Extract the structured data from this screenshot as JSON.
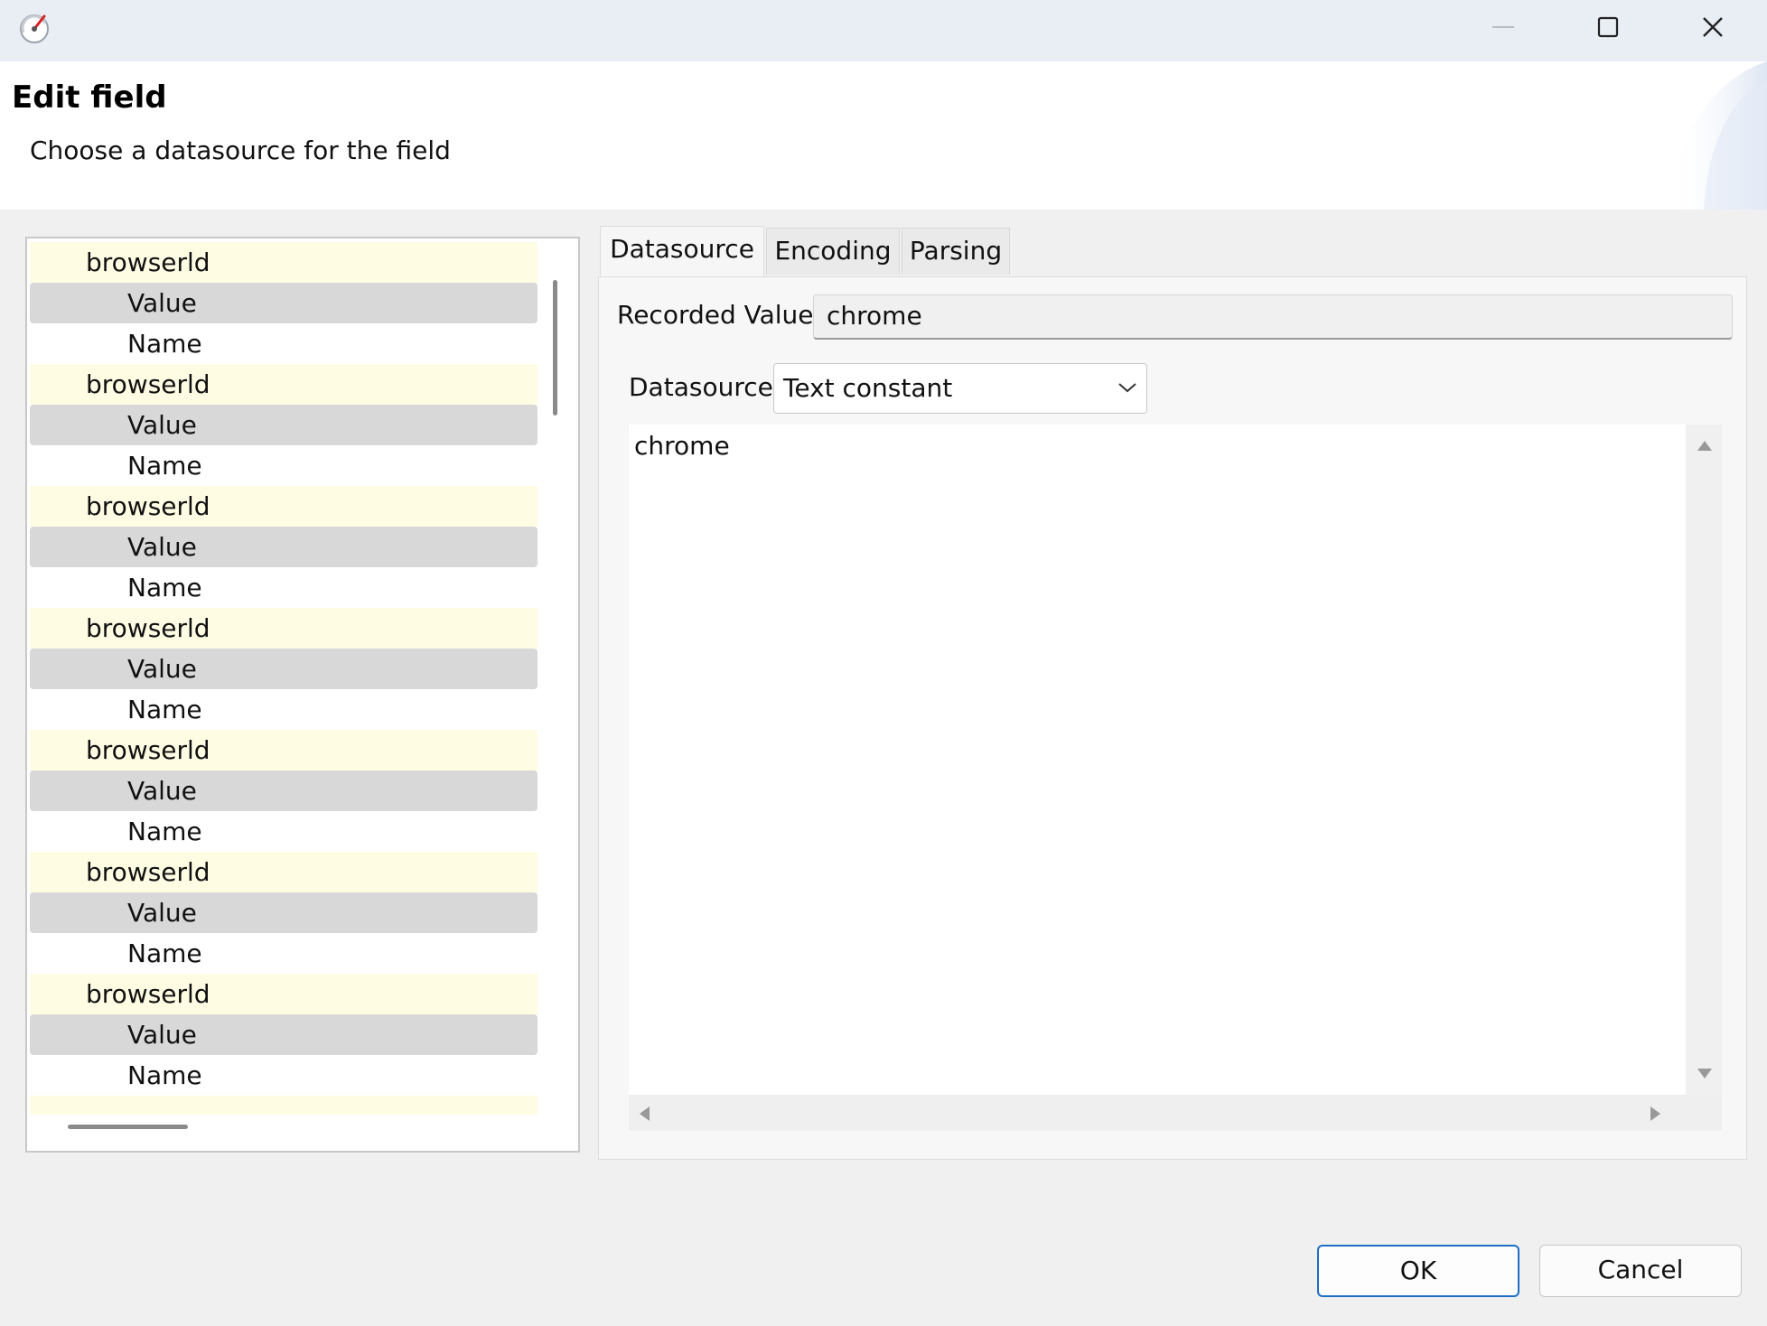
{
  "window": {
    "app_icon": "gauge-icon",
    "controls": {
      "minimize": "minimize-icon",
      "maximize": "maximize-icon",
      "close": "close-icon"
    }
  },
  "header": {
    "title": "Edit field",
    "subtitle": "Choose a datasource for the field"
  },
  "tree": {
    "groups": [
      {
        "parent": "browserld",
        "children": [
          "Value",
          "Name"
        ]
      },
      {
        "parent": "browserld",
        "children": [
          "Value",
          "Name"
        ]
      },
      {
        "parent": "browserld",
        "children": [
          "Value",
          "Name"
        ]
      },
      {
        "parent": "browserld",
        "children": [
          "Value",
          "Name"
        ]
      },
      {
        "parent": "browserld",
        "children": [
          "Value",
          "Name"
        ]
      },
      {
        "parent": "browserld",
        "children": [
          "Value",
          "Name"
        ]
      },
      {
        "parent": "browserld",
        "children": [
          "Value",
          "Name"
        ]
      }
    ],
    "selected_color": "#d8d8d8",
    "parent_color": "#fefde4"
  },
  "tabs": [
    {
      "label": "Datasource",
      "active": true
    },
    {
      "label": "Encoding",
      "active": false
    },
    {
      "label": "Parsing",
      "active": false
    }
  ],
  "datasource_tab": {
    "recorded_label": "Recorded Value",
    "recorded_value": "chrome",
    "datasource_label": "Datasource",
    "datasource_value": "Text constant",
    "text_value": "chrome"
  },
  "buttons": {
    "ok": "OK",
    "cancel": "Cancel"
  },
  "colors": {
    "accent": "#1f6fc5"
  }
}
